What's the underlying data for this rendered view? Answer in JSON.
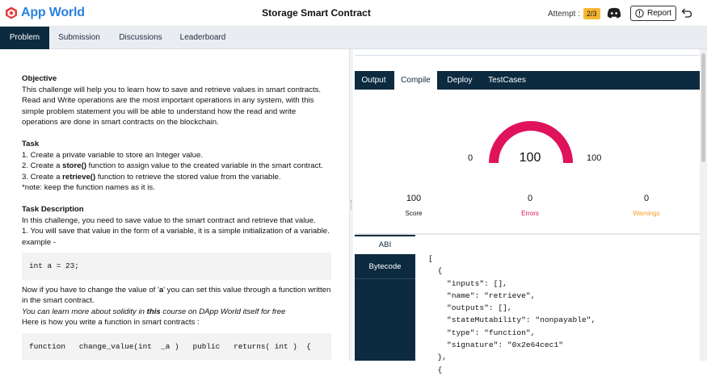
{
  "app": {
    "name": "App World"
  },
  "header": {
    "title": "Storage Smart Contract",
    "attempt_label": "Attempt :",
    "attempt_value": "2/3",
    "report_label": "Report"
  },
  "tabs": [
    {
      "label": "Problem"
    },
    {
      "label": "Submission"
    },
    {
      "label": "Discussions"
    },
    {
      "label": "Leaderboard"
    }
  ],
  "problem": {
    "objective_heading": "Objective",
    "objective_text": "This challenge will help you to learn how to save and retrieve values in smart contracts. Read and Write operations are the most important operations in any system, with this simple problem statement you will be able to understand how the read and write operations are done in smart contracts on the blockchain.",
    "task_heading": "Task",
    "task_1": "1. Create a private variable to store an Integer value.",
    "task_2_pre": "2. Create a ",
    "task_2_bold": "store()",
    "task_2_post": " function to assign value to the created variable in the smart contract.",
    "task_3_pre": "3. Create a ",
    "task_3_bold": "retrieve()",
    "task_3_post": " function to retrieve the stored value from the variable.",
    "task_note": "*note: keep the function names as it is.",
    "desc_heading": "Task Description",
    "desc_1": "In this challenge, you need to save value to the smart contract and retrieve that value.",
    "desc_2": "1. You will save that value in the form of a variable, it is a simple initialization of a variable.",
    "desc_3": "example -",
    "code_1": "int a = 23;",
    "desc_4_pre": "Now if you have to change the value of '",
    "desc_4_bold": "a",
    "desc_4_post": "' you can set this value through a function written in the smart contract.",
    "desc_5_pre": "You can learn more about solidity in ",
    "desc_5_bold": "this",
    "desc_5_post": " course on DApp World itself for free",
    "desc_6": "Here is how you write a function in smart contracts :",
    "code_2": "function   change_value(int  _a )   public   returns( int )  {"
  },
  "result_tabs": [
    {
      "label": "Output"
    },
    {
      "label": "Compile"
    },
    {
      "label": "Deploy"
    },
    {
      "label": "TestCases"
    }
  ],
  "gauge": {
    "min": "0",
    "max": "100",
    "value": "100",
    "fraction": 1.0,
    "color": "#e0125c"
  },
  "stats": [
    {
      "value": "100",
      "label": "Score",
      "color": "#111111"
    },
    {
      "value": "0",
      "label": "Errors",
      "color": "#e0125c"
    },
    {
      "value": "0",
      "label": "Warnings",
      "color": "#f0a020"
    }
  ],
  "abi_tabs": {
    "abi": "ABI",
    "bytecode": "Bytecode"
  },
  "abi_lines": [
    "[",
    "  {",
    "    \"inputs\": [],",
    "    \"name\": \"retrieve\",",
    "    \"outputs\": [],",
    "    \"stateMutability\": \"nonpayable\",",
    "    \"type\": \"function\",",
    "    \"signature\": \"0x2e64cec1\"",
    "  },",
    "  {"
  ]
}
